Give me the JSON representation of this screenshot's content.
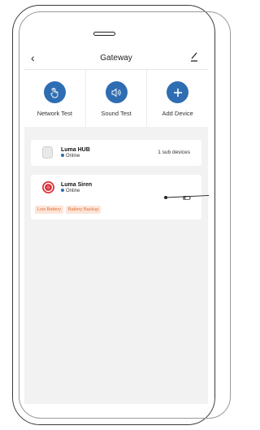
{
  "header": {
    "title": "Gateway",
    "back_icon": "chevron-left-icon",
    "edit_icon": "pencil-icon"
  },
  "actions": [
    {
      "label": "Network Test",
      "icon": "hand-tap-icon"
    },
    {
      "label": "Sound Test",
      "icon": "speaker-icon"
    },
    {
      "label": "Add Device",
      "icon": "plus-icon"
    }
  ],
  "devices": [
    {
      "name": "Luma HUB",
      "status": "Online",
      "sub_devices": "1 sub devices"
    },
    {
      "name": "Luma Siren",
      "status": "Online",
      "tags": [
        "Low Battery",
        "Battery Backup"
      ]
    }
  ],
  "colors": {
    "accent": "#2f6db3",
    "tag_text": "#e0703a",
    "tag_bg": "#fde5d8",
    "siren": "#d9313b"
  }
}
